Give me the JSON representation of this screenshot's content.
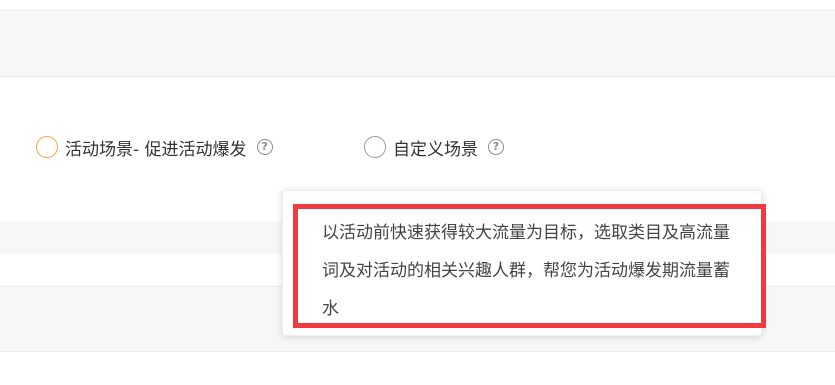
{
  "scene_options": [
    {
      "label": "活动场景- 促进活动爆发",
      "selected": true,
      "help_icon": "question-circle-icon"
    },
    {
      "label": "自定义场景",
      "selected": false,
      "help_icon": "question-circle-icon"
    }
  ],
  "help_glyph": "?",
  "tooltip": {
    "text": "以活动前快速获得较大流量为目标，选取类目及高流量词及对活动的相关兴趣人群，帮您为活动爆发期流量蓄水"
  },
  "colors": {
    "selected_radio_border": "#f2a33a",
    "highlight_border": "#ef3b3f"
  }
}
